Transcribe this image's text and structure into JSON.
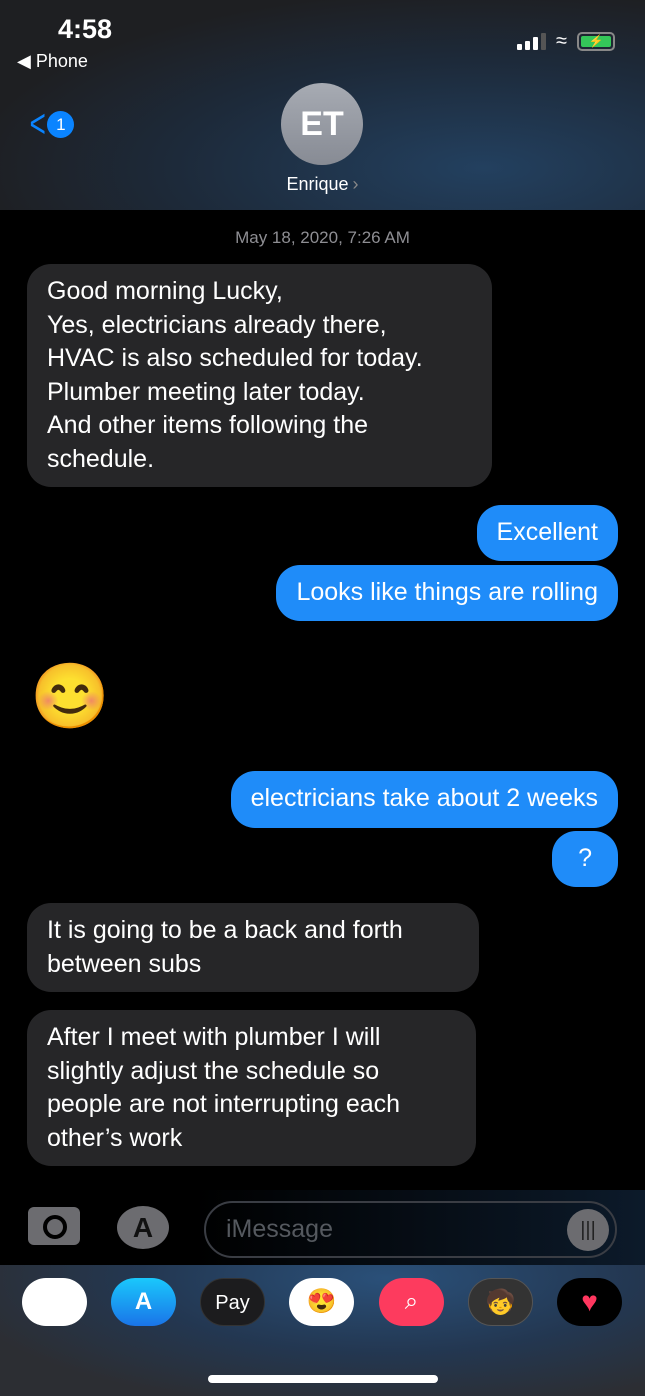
{
  "status_bar": {
    "time": "4:58",
    "back_app": "Phone",
    "battery_color": "#34c759"
  },
  "header": {
    "unread_count": "1",
    "avatar_initials": "ET",
    "contact_name": "Enrique"
  },
  "conversation": {
    "timestamp": "May 18, 2020, 7:26 AM",
    "messages": [
      {
        "direction": "received",
        "text": "Good morning Lucky,\nYes, electricians already there,\nHVAC is also scheduled for today.\nPlumber meeting later today.\nAnd other items following the schedule."
      },
      {
        "direction": "sent",
        "text": "Excellent"
      },
      {
        "direction": "sent",
        "text": "Looks like things are rolling"
      },
      {
        "direction": "received",
        "text": "😊"
      },
      {
        "direction": "sent",
        "text": "electricians take about 2 weeks"
      },
      {
        "direction": "sent",
        "text": "?"
      },
      {
        "direction": "received",
        "text": "It is going to be a back and forth between subs"
      },
      {
        "direction": "received",
        "text": "After I meet with plumber I will slightly adjust the schedule so people are not interrupting each other’s work"
      }
    ]
  },
  "composer": {
    "placeholder": "iMessage"
  },
  "app_drawer": {
    "apple_pay_label": "Pay",
    "apps": [
      "photos-icon",
      "app-store-icon",
      "apple-pay-icon",
      "memoji-stickers-icon",
      "web-images-search-icon",
      "animoji-icon",
      "digital-touch-icon"
    ]
  },
  "colors": {
    "sent_bubble": "#1f8cf9",
    "received_bubble": "#262628",
    "accent": "#0a84ff"
  }
}
